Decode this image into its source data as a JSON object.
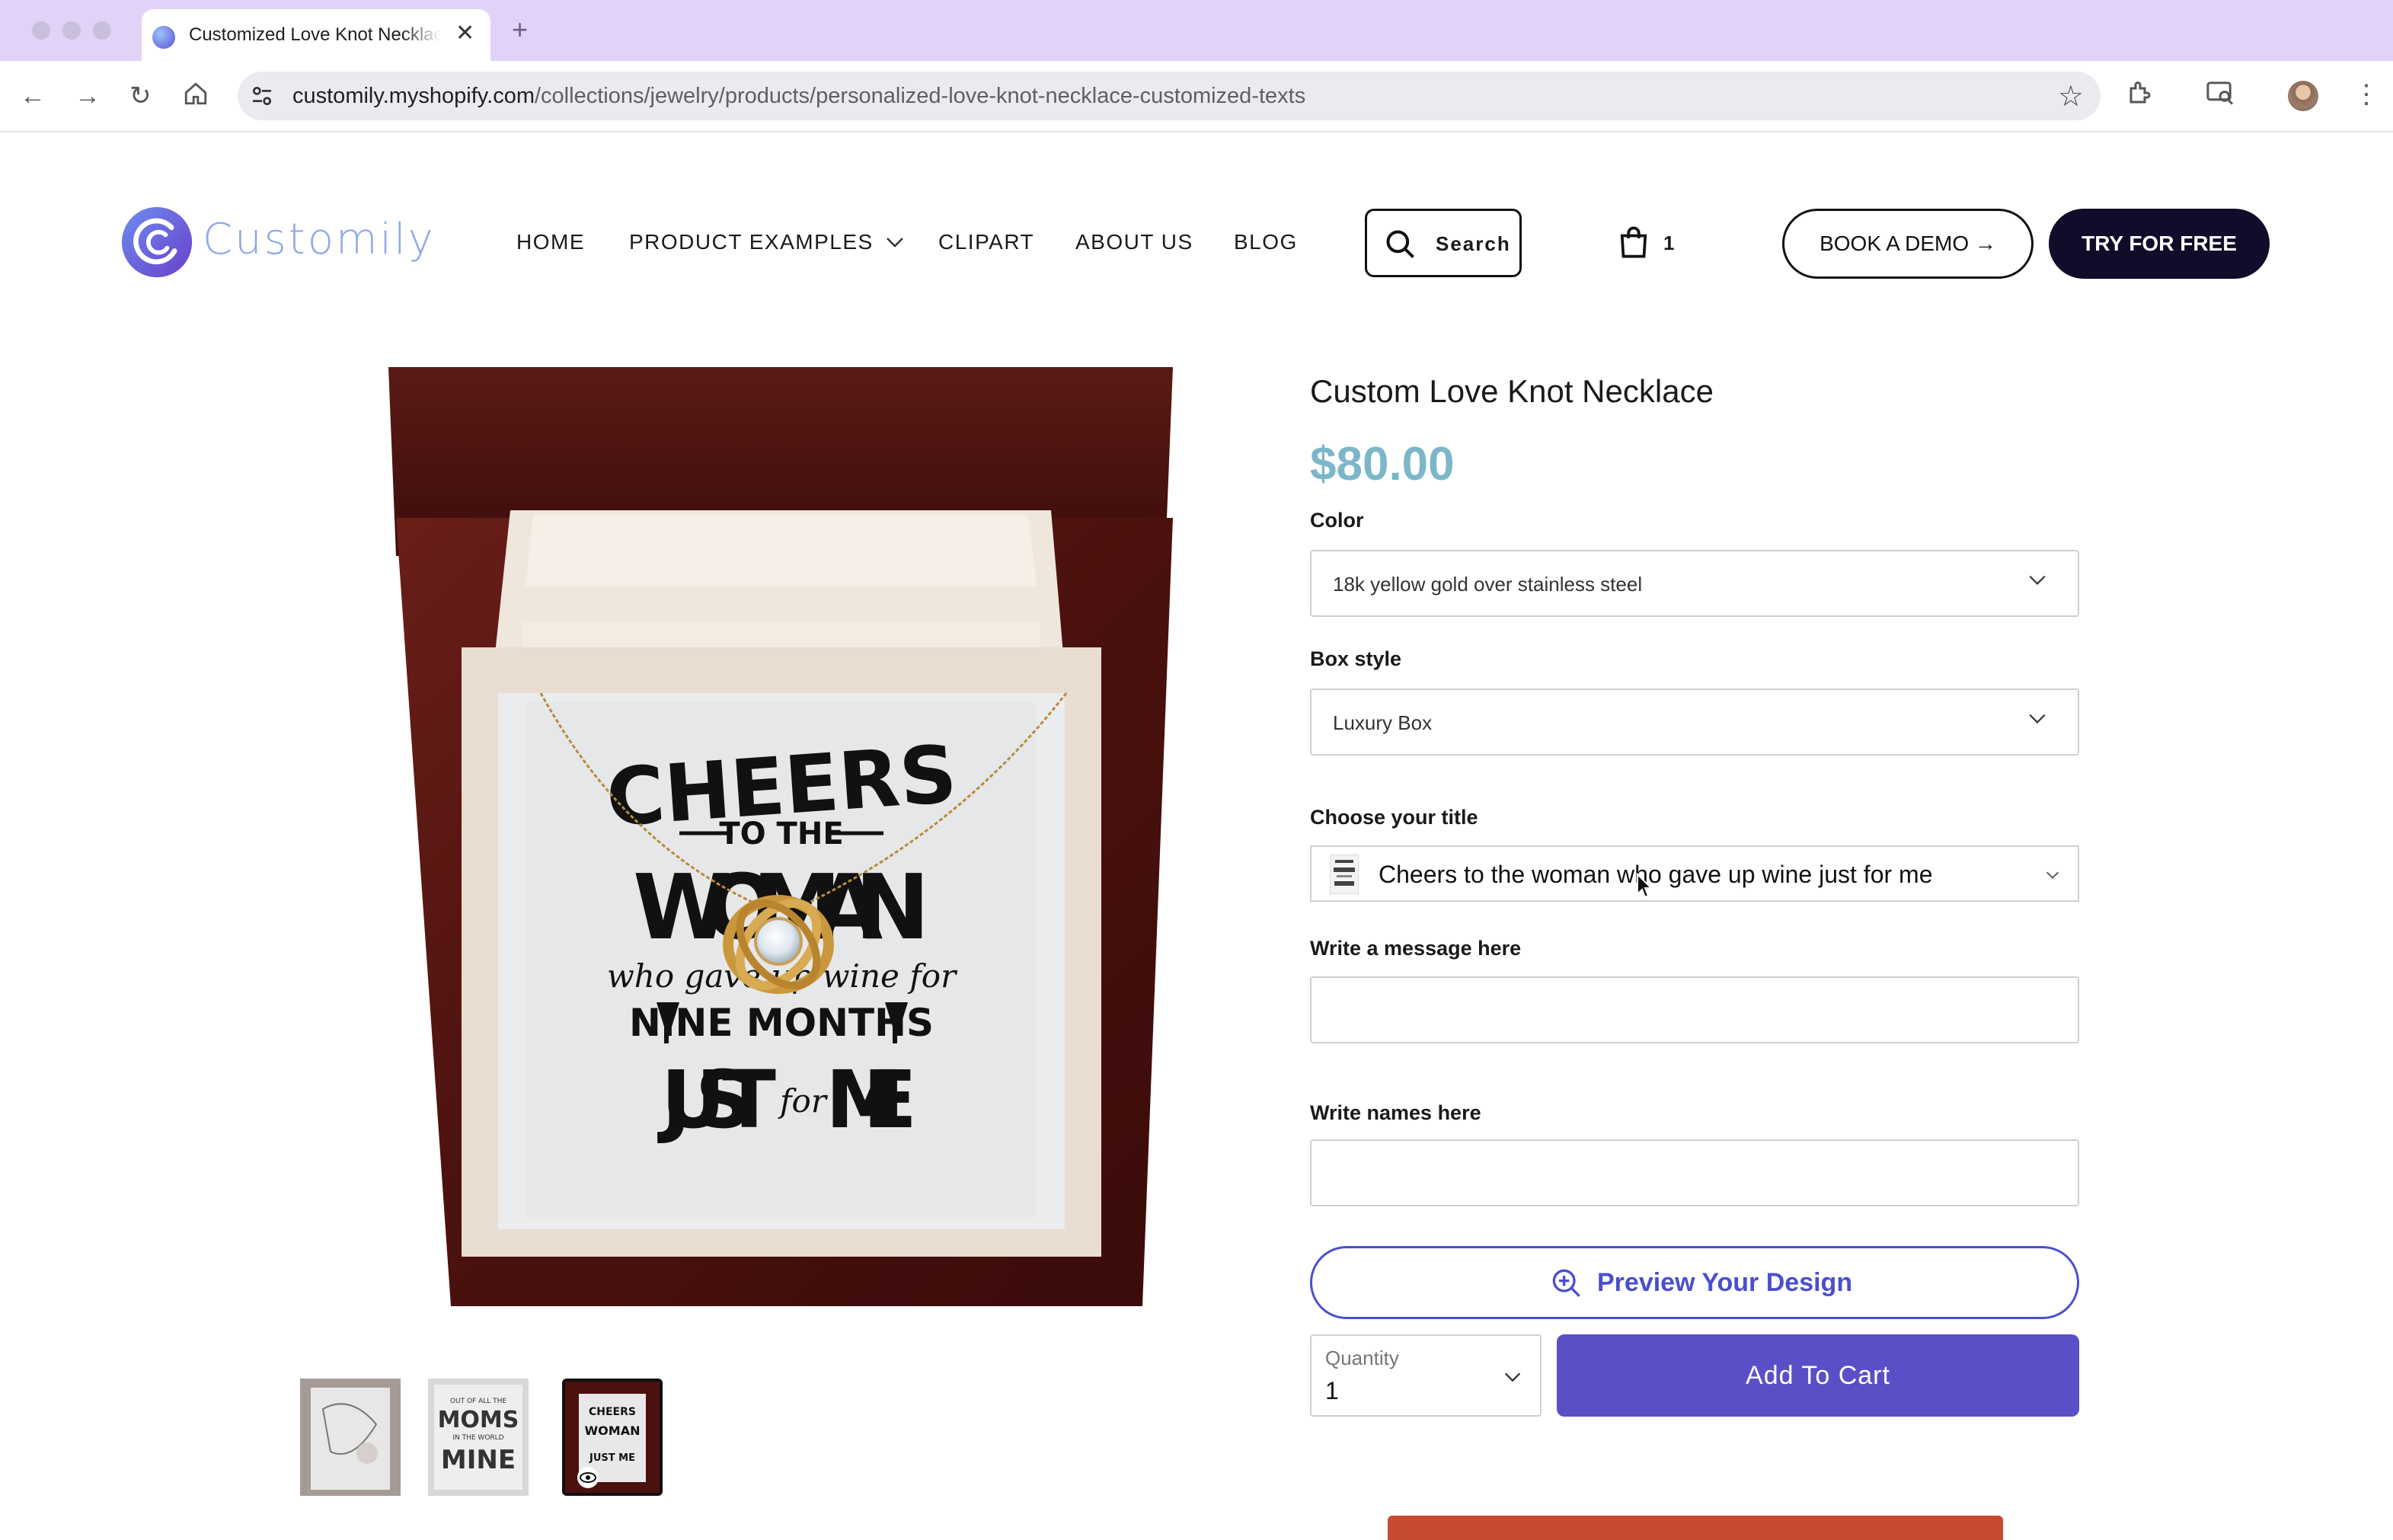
{
  "browser": {
    "tab_title": "Customized Love Knot Necklace",
    "url_domain": "customily.myshopify.com",
    "url_path": "/collections/jewelry/products/personalized-love-knot-necklace-customized-texts"
  },
  "site": {
    "logo_text": "Customily",
    "nav": [
      "HOME",
      "PRODUCT EXAMPLES",
      "CLIPART",
      "ABOUT US",
      "BLOG"
    ],
    "search_label": "Search",
    "cart_count": "1",
    "demo_label": "BOOK A DEMO →",
    "try_label": "TRY FOR FREE"
  },
  "product": {
    "title": "Custom Love Knot Necklace",
    "price": "$80.00",
    "price_color": "#7cb7c9",
    "color_label": "Color",
    "color_value": "18k yellow gold over stainless steel",
    "box_label": "Box style",
    "box_value": "Luxury Box",
    "title_label": "Choose your title",
    "title_value": "Cheers to the woman who gave up wine just for me",
    "message_label": "Write a message here",
    "names_label": "Write names here",
    "preview_label": "Preview Your Design",
    "qty_label": "Quantity",
    "qty_value": "1",
    "add_label": "Add To Cart",
    "accent_color": "#5a4fc6"
  },
  "card_art": {
    "line1": "CHEERS",
    "line2": "TO THE",
    "line3": "WOMAN",
    "line4": "who gave up wine for",
    "line5": "NINE MONTHS",
    "line6a": "JUST",
    "line6b": "for",
    "line6c": "ME"
  },
  "thumbnails": [
    {
      "name": "motherhood-card"
    },
    {
      "name": "moms-card",
      "line1": "OUT OF ALL THE",
      "line2": "MOMS",
      "line3": "IN THE WORLD",
      "line4": "MINE"
    },
    {
      "name": "cheers-card",
      "line1": "CHEERS",
      "line2": "WOMAN",
      "line3": "JUST ME"
    }
  ]
}
